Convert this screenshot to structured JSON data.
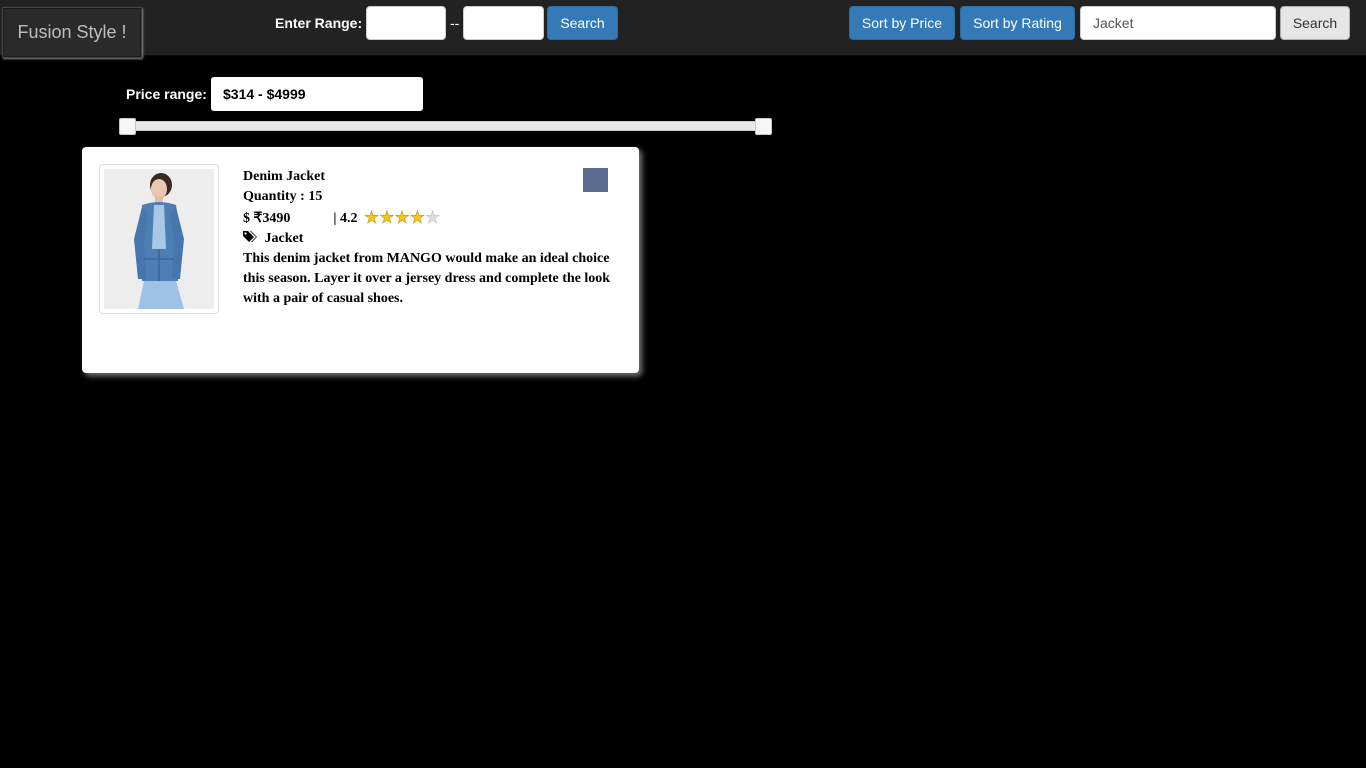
{
  "nav": {
    "brand": "Fusion Style !",
    "range_label": "Enter Range:",
    "range_min_value": "",
    "range_separator": "--",
    "range_max_value": "",
    "range_search_label": "Search",
    "sort_price_label": "Sort by Price",
    "sort_rating_label": "Sort by Rating",
    "search_value": "Jacket",
    "search_button_label": "Search"
  },
  "filter": {
    "price_label": "Price range:",
    "price_value": "$314 - $4999",
    "slider_min_fraction": 0,
    "slider_max_fraction": 1
  },
  "products": [
    {
      "name": "Denim Jacket",
      "quantity": "Quantity : 15",
      "price_prefix": "$",
      "price": "₹3490",
      "rating_sep": "|",
      "rating": "4.2",
      "stars_filled": 4,
      "stars_total": 5,
      "category": "Jacket",
      "description": "This denim jacket from MANGO would make an ideal choice this season. Layer it over a jersey dress and complete the look with a pair of casual shoes.",
      "color": "#5a6d8f",
      "tag_icon": "tags-icon",
      "image_icon": "product-photo"
    }
  ],
  "colors": {
    "primary": "#337ab7",
    "navbar": "#222222",
    "background": "#000000",
    "star_filled": "#f5c518",
    "star_empty": "#dddddd"
  }
}
